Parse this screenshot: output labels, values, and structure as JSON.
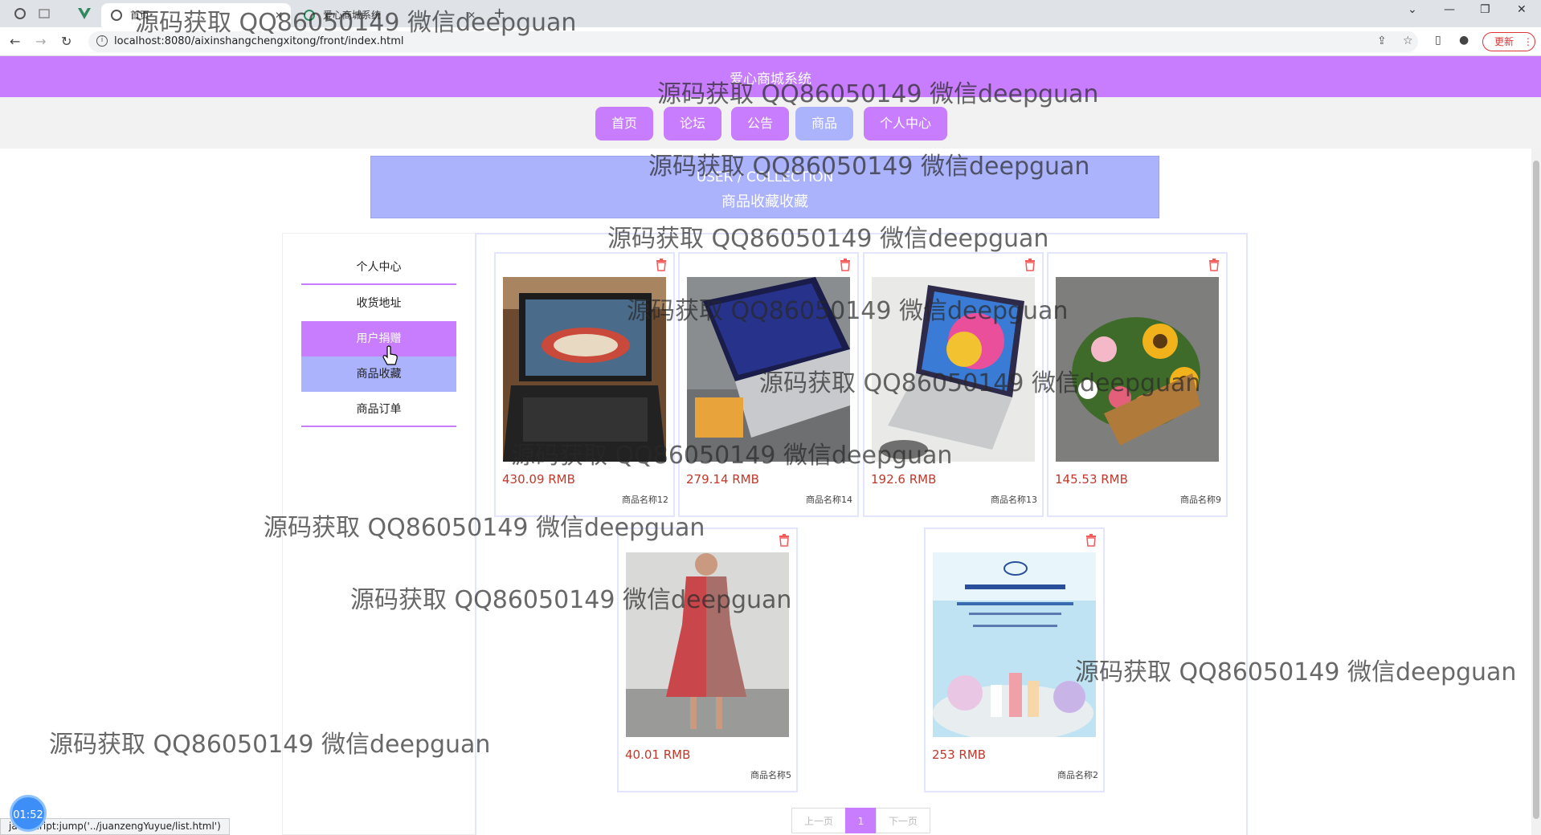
{
  "browser": {
    "tabs": [
      {
        "title": "首页",
        "active": true
      },
      {
        "title": "爱心商城系统",
        "active": false
      }
    ],
    "url": "localhost:8080/aixinshangchengxitong/front/index.html",
    "update_label": "更新",
    "status_url": "javascript:jump('../juanzengYuyue/list.html')"
  },
  "site": {
    "title": "爱心商城系统",
    "menu": [
      {
        "label": "首页",
        "active": false
      },
      {
        "label": "论坛",
        "active": false
      },
      {
        "label": "公告",
        "active": false
      },
      {
        "label": "商品",
        "active": true
      },
      {
        "label": "个人中心",
        "active": false
      }
    ]
  },
  "banner": {
    "en": "USER / COLLECTION",
    "zh": "商品收藏收藏"
  },
  "sidebar": {
    "items": [
      {
        "label": "个人中心"
      },
      {
        "label": "收货地址"
      },
      {
        "label": "用户捐赠"
      },
      {
        "label": "商品收藏"
      },
      {
        "label": "商品订单"
      }
    ]
  },
  "products": [
    {
      "price": "430.09 RMB",
      "name": "商品名称12",
      "image": "laptop-game-photo"
    },
    {
      "price": "279.14 RMB",
      "name": "商品名称14",
      "image": "silver-laptop-photo"
    },
    {
      "price": "192.6 RMB",
      "name": "商品名称13",
      "image": "colorful-laptop-photo"
    },
    {
      "price": "145.53 RMB",
      "name": "商品名称9",
      "image": "flower-basket-photo"
    },
    {
      "price": "40.01 RMB",
      "name": "商品名称5",
      "image": "red-dress-photo"
    },
    {
      "price": "253 RMB",
      "name": "商品名称2",
      "image": "skincare-poster-photo"
    }
  ],
  "pagination": {
    "prev": "上一页",
    "current": "1",
    "next": "下一页"
  },
  "timer": "01:52",
  "watermark": "源码获取 QQ86050149 微信deepguan",
  "colors": {
    "primary": "#c77dfd",
    "secondary": "#aab3fb",
    "price": "#c0392b"
  }
}
